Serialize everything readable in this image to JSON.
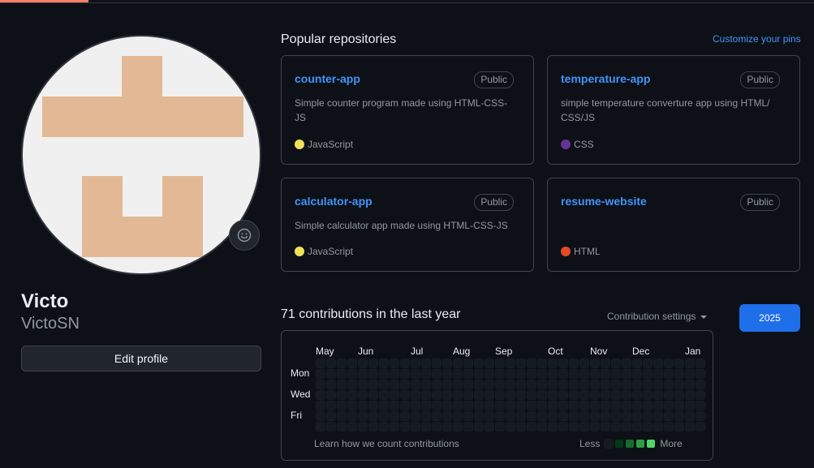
{
  "profile": {
    "display_name": "Victo",
    "username": "VictoSN",
    "edit_button": "Edit profile"
  },
  "popular": {
    "title": "Popular repositories",
    "customize_link": "Customize your pins",
    "repos": [
      {
        "name": "counter-app",
        "visibility": "Public",
        "description": "Simple counter program made using HTML-CSS-JS",
        "language": "JavaScript",
        "language_color": "#f1e05a"
      },
      {
        "name": "temperature-app",
        "visibility": "Public",
        "description": "simple temperature converture app using HTML/ CSS/JS",
        "language": "CSS",
        "language_color": "#663399"
      },
      {
        "name": "calculator-app",
        "visibility": "Public",
        "description": "Simple calculator app made using HTML-CSS-JS",
        "language": "JavaScript",
        "language_color": "#f1e05a"
      },
      {
        "name": "resume-website",
        "visibility": "Public",
        "description": "",
        "language": "HTML",
        "language_color": "#e34c26"
      }
    ]
  },
  "contributions": {
    "title": "71 contributions in the last year",
    "settings_label": "Contribution settings",
    "year": "2025",
    "months": [
      "May",
      "Jun",
      "Jul",
      "Aug",
      "Sep",
      "Oct",
      "Nov",
      "Dec",
      "Jan"
    ],
    "days": [
      "Mon",
      "Wed",
      "Fri"
    ],
    "learn_link": "Learn how we count contributions",
    "legend_less": "Less",
    "legend_more": "More",
    "legend_colors": [
      "#151b23",
      "#033a16",
      "#196c2e",
      "#2ea043",
      "#56d364"
    ]
  },
  "colors": {
    "accent": "#4493f8",
    "year_button": "#1f6feb",
    "avatar_pattern": "#e2b994"
  },
  "icons": {
    "status": "smiley-icon",
    "caret": "caret-down-icon"
  }
}
